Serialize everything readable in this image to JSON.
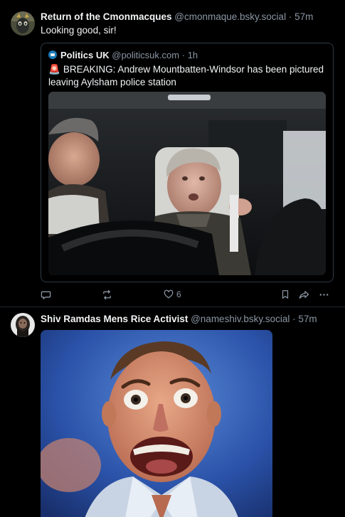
{
  "posts": [
    {
      "author_name": "Return of the Cmonmacques",
      "author_handle": "@cmonmaque.bsky.social",
      "separator": "·",
      "time": "57m",
      "text": "Looking good, sir!",
      "quote": {
        "author_name": "Politics UK",
        "author_handle": "@politicsuk.com",
        "separator": "·",
        "time": "1h",
        "text": "BREAKING: Andrew Mountbatten-Windsor has been pictured leaving Aylsham police station",
        "siren": "🚨"
      },
      "actions": {
        "like_count": "6"
      }
    },
    {
      "author_name": "Shiv Ramdas Mens Rice Activist",
      "author_handle": "@nameshiv.bsky.social",
      "separator": "·",
      "time": "57m"
    }
  ],
  "colors": {
    "background": "#000000",
    "text_primary": "#f1f3f5",
    "text_secondary": "#8a96a3",
    "border": "#2e3a46",
    "siren": "#e0243a"
  },
  "icons": [
    "reply-icon",
    "repost-icon",
    "like-icon",
    "bookmark-icon",
    "share-icon",
    "more-icon"
  ]
}
